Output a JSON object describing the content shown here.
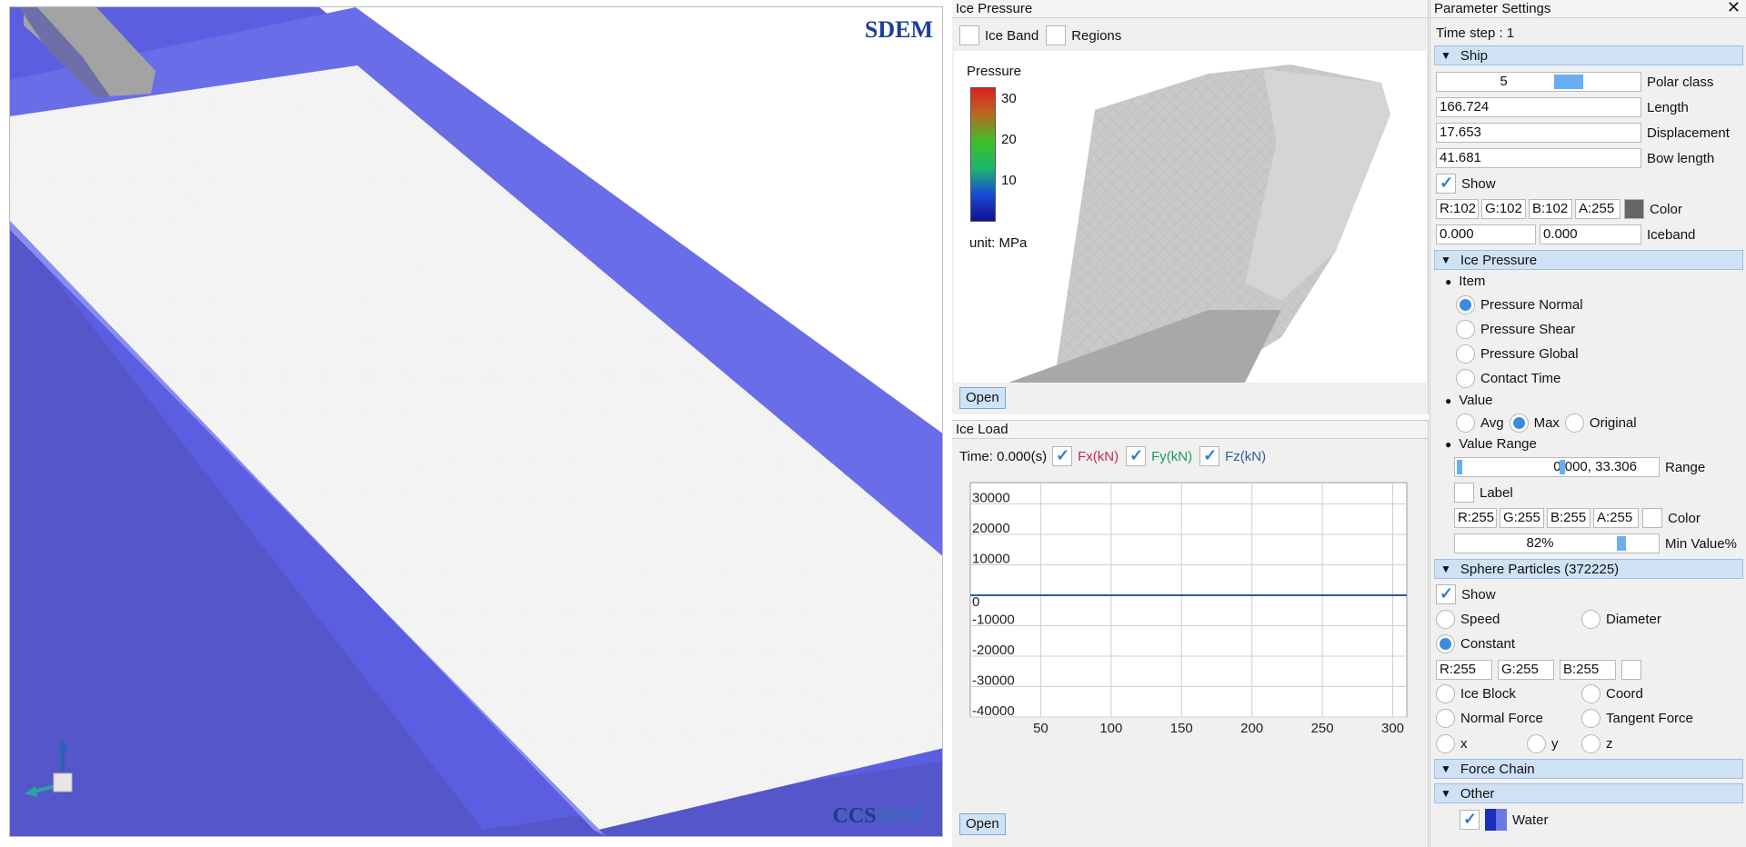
{
  "viewport": {
    "logo_top": "SDEM",
    "logo_bottom_a": "CCS",
    "logo_bottom_b": "DUT"
  },
  "ice_pressure": {
    "title": "Ice Pressure",
    "ice_band_label": "Ice Band",
    "regions_label": "Regions",
    "legend_title": "Pressure",
    "legend_ticks": [
      "30",
      "20",
      "10"
    ],
    "unit": "unit: MPa",
    "open_label": "Open"
  },
  "ice_load": {
    "title": "Ice Load",
    "time_label": "Time: 0.000(s)",
    "fx_label": "Fx(kN)",
    "fy_label": "Fy(kN)",
    "fz_label": "Fz(kN)",
    "open_label": "Open",
    "colors": {
      "fx": "#c8264f",
      "fy": "#1f9a5a",
      "fz": "#2c5d9e"
    }
  },
  "chart_data": {
    "type": "line",
    "title": "",
    "xlabel": "",
    "ylabel": "",
    "x_ticks": [
      "50",
      "100",
      "150",
      "200",
      "250",
      "300"
    ],
    "y_ticks": [
      "30000",
      "20000",
      "10000",
      "0",
      "-10000",
      "-20000",
      "-30000",
      "-40000"
    ],
    "xlim": [
      0,
      310
    ],
    "ylim": [
      -40000,
      37000
    ],
    "grid": true,
    "series": [
      {
        "x": [
          0,
          310
        ],
        "values": [
          0,
          0
        ],
        "color": "#2c5d9e"
      }
    ]
  },
  "params": {
    "title": "Parameter Settings",
    "close_icon": "close-icon",
    "time_step": "Time step : 1",
    "ship": {
      "header": "Ship",
      "polar_class_value": "5",
      "polar_class_label": "Polar class",
      "polar_class_level": 0.5,
      "length_value": "166.724",
      "length_label": "Length",
      "displacement_value": "17.653",
      "displacement_label": "Displacement",
      "bow_length_value": "41.681",
      "bow_length_label": "Bow length",
      "show_label": "Show",
      "r": "R:102",
      "g": "G:102",
      "b": "B:102",
      "a": "A:255",
      "color_label": "Color",
      "color_swatch": "#666666",
      "iceband_a": "0.000",
      "iceband_b": "0.000",
      "iceband_label": "Iceband"
    },
    "ice_pressure": {
      "header": "Ice Pressure",
      "item_label": "Item",
      "items": [
        "Pressure Normal",
        "Pressure Shear",
        "Pressure Global",
        "Contact Time"
      ],
      "value_label": "Value",
      "value_opts": [
        "Avg",
        "Max",
        "Original"
      ],
      "value_range_label": "Value Range",
      "range_value": "0.000, 33.306",
      "range_label": "Range",
      "label_label": "Label",
      "r": "R:255",
      "g": "G:255",
      "b": "B:255",
      "a": "A:255",
      "color_label": "Color",
      "min_value_pct": "82%",
      "min_value_level": 0.82,
      "min_value_label": "Min Value%"
    },
    "sphere": {
      "header": "Sphere Particles (372225)",
      "show_label": "Show",
      "speed_label": "Speed",
      "diameter_label": "Diameter",
      "constant_label": "Constant",
      "r": "R:255",
      "g": "G:255",
      "b": "B:255",
      "ice_block_label": "Ice Block",
      "coord_label": "Coord",
      "normal_force_label": "Normal Force",
      "tangent_force_label": "Tangent Force",
      "x_label": "x",
      "y_label": "y",
      "z_label": "z"
    },
    "force_chain_header": "Force Chain",
    "other": {
      "header": "Other",
      "water_label": "Water"
    }
  }
}
